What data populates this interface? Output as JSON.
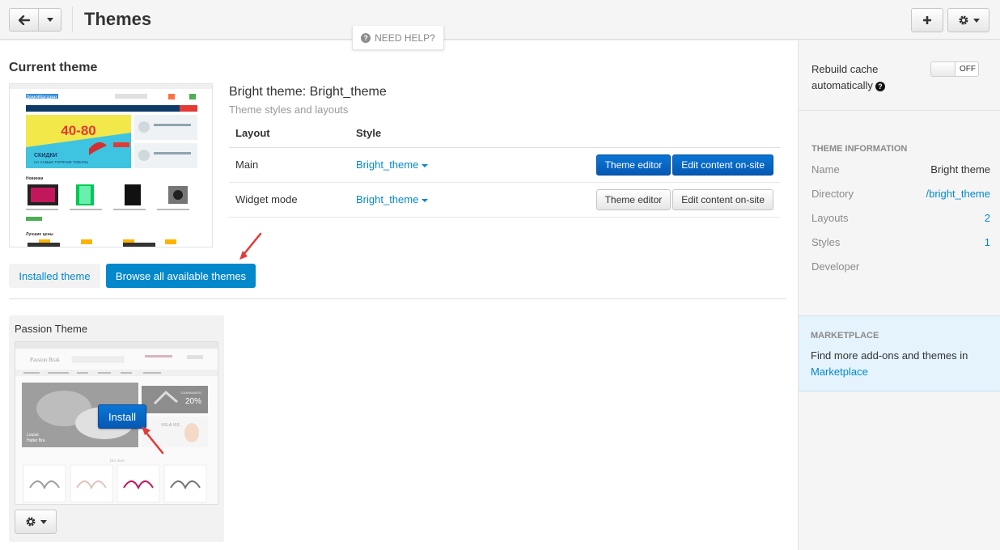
{
  "header": {
    "title": "Themes",
    "need_help": "NEED HELP?"
  },
  "current_theme": {
    "section_title": "Current theme",
    "name": "Bright theme: Bright_theme",
    "subtitle": "Theme styles and layouts",
    "preview": {
      "promo_big": "40-80",
      "promo_line1": "СКИДКИ",
      "promo_line2": "НА САМЫЕ ГОРЯЧИЕ ТОВАРЫ",
      "shop_name": "ДемоМагазин",
      "section_new": "Новинки",
      "section_best": "Лучшие цены"
    },
    "table": {
      "col_layout": "Layout",
      "col_style": "Style",
      "rows": [
        {
          "layout": "Main",
          "style": "Bright_theme",
          "editor": "Theme editor",
          "content": "Edit content on-site"
        },
        {
          "layout": "Widget mode",
          "style": "Bright_theme",
          "editor": "Theme editor",
          "content": "Edit content on-site"
        }
      ]
    }
  },
  "tabs": {
    "installed": "Installed theme",
    "browse": "Browse all available themes"
  },
  "available": [
    {
      "title": "Passion Theme",
      "install_label": "Install",
      "preview": {
        "brand": "Passion Brak",
        "promo_big": "20%",
        "promo_label": "CHARMANTE",
        "promo2": "VIS-A-VIS",
        "caption_line1": "Louise",
        "caption_line2": "Halter Bra",
        "hot_deals": "Hot deals"
      }
    }
  ],
  "sidebar": {
    "rebuild_label": "Rebuild cache automatically",
    "toggle_state": "OFF",
    "info_heading": "Theme information",
    "info": [
      {
        "key": "Name",
        "value": "Bright theme",
        "link": false
      },
      {
        "key": "Directory",
        "value": "/bright_theme",
        "link": true
      },
      {
        "key": "Layouts",
        "value": "2",
        "link": true
      },
      {
        "key": "Styles",
        "value": "1",
        "link": true
      },
      {
        "key": "Developer",
        "value": "",
        "link": false
      }
    ],
    "marketplace_heading": "Marketplace",
    "marketplace_text": "Find more add-ons and themes in",
    "marketplace_link": "Marketplace"
  },
  "colors": {
    "accent": "#0388cc",
    "primary_button": "#0559b3",
    "annotation_arrow": "#e53935"
  }
}
